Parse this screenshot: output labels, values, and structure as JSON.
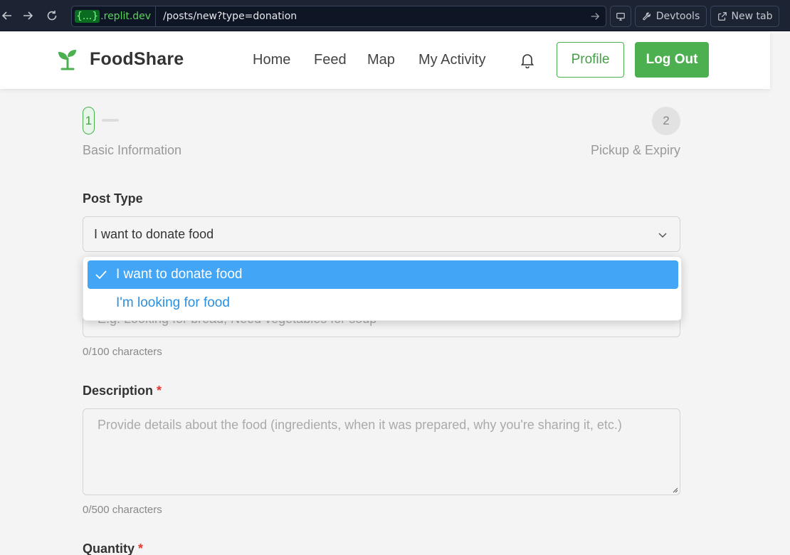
{
  "browser": {
    "url_host_brace": "{...}",
    "url_host": ".replit.dev",
    "url_path": "/posts/new?type=donation",
    "devtools_label": "Devtools",
    "newtab_label": "New tab"
  },
  "header": {
    "brand": "FoodShare",
    "nav": [
      "Home",
      "Feed",
      "Map",
      "My Activity"
    ],
    "profile_label": "Profile",
    "logout_label": "Log Out"
  },
  "stepper": {
    "steps": [
      {
        "number": "1",
        "label": "Basic Information",
        "active": true
      },
      {
        "number": "2",
        "label": "Pickup & Expiry",
        "active": false
      }
    ]
  },
  "form": {
    "post_type": {
      "label": "Post Type",
      "value": "I want to donate food",
      "options": [
        "I want to donate food",
        "I'm looking for food"
      ],
      "selected_index": 0
    },
    "title": {
      "placeholder": "E.g. Looking for bread, Need vegetables for soup",
      "counter": "0/100 characters"
    },
    "description": {
      "label": "Description",
      "required_mark": "*",
      "placeholder": "Provide details about the food (ingredients, when it was prepared, why you're sharing it, etc.)",
      "counter": "0/500 characters"
    },
    "quantity": {
      "label": "Quantity",
      "required_mark": "*"
    }
  },
  "colors": {
    "brand_green": "#4caf50",
    "selected_option": "#42a5f5",
    "required": "#e53935"
  }
}
